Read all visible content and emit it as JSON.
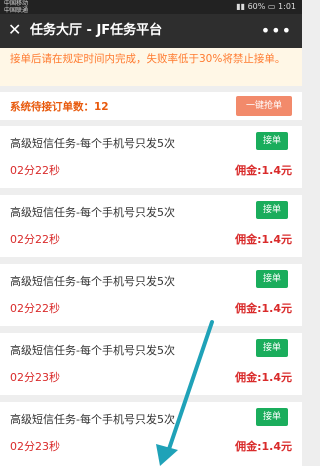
{
  "status_bar": {
    "carrier": "中国移动\n中国联通",
    "battery": "60%",
    "time": "1:01"
  },
  "header": {
    "close_symbol": "✕",
    "title": "任务大厅 - JF任务平台",
    "more_symbol": "•••"
  },
  "notice": "接单后请在规定时间内完成，失败率低于30%将禁止接单。",
  "pending": {
    "label": "系统待接订单数：",
    "count": "12",
    "grab_all_label": "一键抢单"
  },
  "tasks": [
    {
      "name": "高级短信任务-每个手机号只发5次",
      "accept_label": "接单",
      "timer": "02分22秒",
      "commission": "佣金:1.4元"
    },
    {
      "name": "高级短信任务-每个手机号只发5次",
      "accept_label": "接单",
      "timer": "02分22秒",
      "commission": "佣金:1.4元"
    },
    {
      "name": "高级短信任务-每个手机号只发5次",
      "accept_label": "接单",
      "timer": "02分22秒",
      "commission": "佣金:1.4元"
    },
    {
      "name": "高级短信任务-每个手机号只发5次",
      "accept_label": "接单",
      "timer": "02分23秒",
      "commission": "佣金:1.4元"
    },
    {
      "name": "高级短信任务-每个手机号只发5次",
      "accept_label": "接单",
      "timer": "02分23秒",
      "commission": "佣金:1.4元"
    }
  ],
  "colors": {
    "accept_button": "#1aad5c",
    "grab_button": "#f28a6b",
    "notice_text": "#ff7a2f",
    "price_text": "#d92b2b",
    "overlay_arrow": "#1fa2b8"
  }
}
